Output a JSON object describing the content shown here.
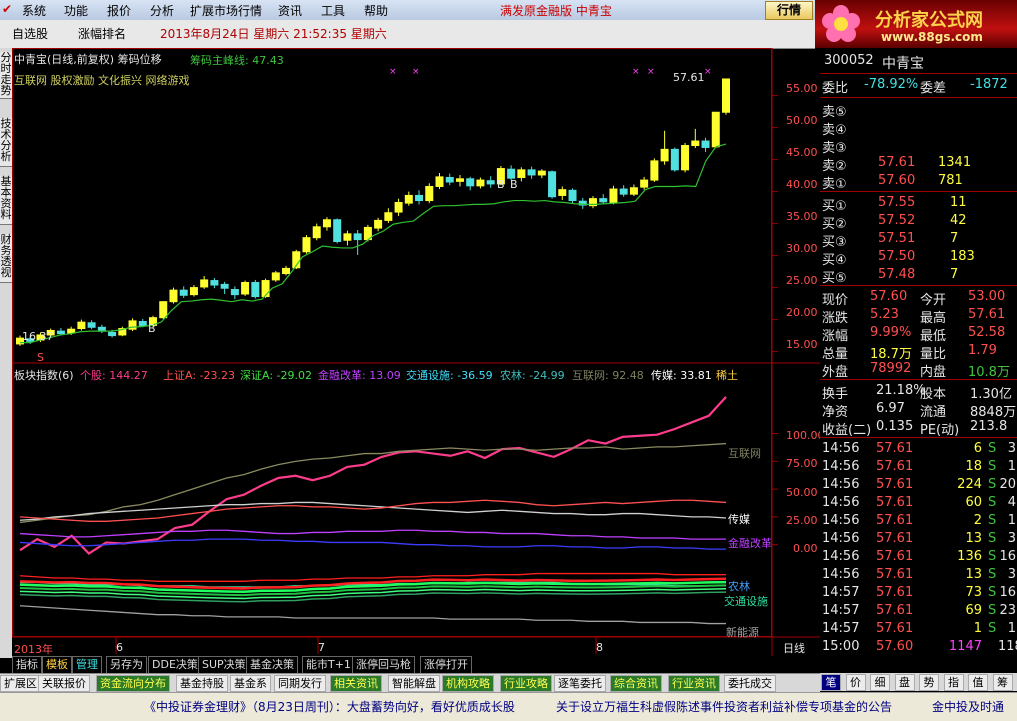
{
  "menu": {
    "items": [
      "系统",
      "功能",
      "报价",
      "分析",
      "扩展市场行情",
      "资讯",
      "工具",
      "帮助"
    ],
    "scroll_text": "满发原金融版  中青宝",
    "quote_button": "行情"
  },
  "banner": {
    "title": "分析家公式网",
    "url": "www.88gs.com"
  },
  "tabs": {
    "watchlist": "自选股",
    "ranking": "涨幅排名",
    "datetime": "2013年8月24日  星期六  21:52:35 星期六"
  },
  "side_tabs": [
    "分时走势",
    "技术分析",
    "基本资料",
    "财务透视"
  ],
  "main_chart": {
    "title": "中青宝(日线,前复权) 筹码位移",
    "indicator": "筹码主峰线: 47.43",
    "concepts": "互联网 股权激励 文化振兴 网络游戏",
    "high_label": "57.61",
    "low_label": "16.37",
    "b_marks": [
      "B",
      "B",
      "B"
    ],
    "s_mark": "S",
    "y_ticks": [
      "55.00",
      "50.00",
      "45.00",
      "40.00",
      "35.00",
      "30.00",
      "25.00",
      "20.00",
      "15.00"
    ]
  },
  "chart_data": {
    "type": "line",
    "x_labels": [
      "2013年",
      "6",
      "7",
      "8"
    ],
    "candles": [
      {
        "o": 16.2,
        "c": 17.1,
        "h": 17.5,
        "l": 15.9
      },
      {
        "o": 17.0,
        "c": 16.6,
        "h": 17.3,
        "l": 16.2
      },
      {
        "o": 16.8,
        "c": 17.6,
        "h": 18.0,
        "l": 16.5
      },
      {
        "o": 17.6,
        "c": 18.3,
        "h": 18.6,
        "l": 17.2
      },
      {
        "o": 18.2,
        "c": 17.8,
        "h": 18.7,
        "l": 17.5
      },
      {
        "o": 17.9,
        "c": 18.5,
        "h": 18.9,
        "l": 17.6
      },
      {
        "o": 18.6,
        "c": 19.6,
        "h": 20.0,
        "l": 18.3
      },
      {
        "o": 19.5,
        "c": 18.8,
        "h": 19.9,
        "l": 18.5
      },
      {
        "o": 18.8,
        "c": 18.2,
        "h": 19.2,
        "l": 17.9
      },
      {
        "o": 18.0,
        "c": 17.5,
        "h": 18.4,
        "l": 17.2
      },
      {
        "o": 17.6,
        "c": 18.6,
        "h": 18.9,
        "l": 17.4
      },
      {
        "o": 18.5,
        "c": 19.8,
        "h": 20.2,
        "l": 18.2
      },
      {
        "o": 19.7,
        "c": 19.0,
        "h": 20.1,
        "l": 18.8
      },
      {
        "o": 19.1,
        "c": 20.3,
        "h": 20.6,
        "l": 18.9
      },
      {
        "o": 20.3,
        "c": 22.8,
        "h": 22.9,
        "l": 20.1
      },
      {
        "o": 22.8,
        "c": 24.6,
        "h": 25.0,
        "l": 22.5
      },
      {
        "o": 24.6,
        "c": 23.8,
        "h": 25.2,
        "l": 23.4
      },
      {
        "o": 23.9,
        "c": 25.0,
        "h": 25.4,
        "l": 23.6
      },
      {
        "o": 25.1,
        "c": 26.2,
        "h": 26.8,
        "l": 24.8
      },
      {
        "o": 26.1,
        "c": 25.4,
        "h": 26.5,
        "l": 24.9
      },
      {
        "o": 25.5,
        "c": 24.9,
        "h": 25.9,
        "l": 24.0
      },
      {
        "o": 24.7,
        "c": 23.9,
        "h": 25.2,
        "l": 23.2
      },
      {
        "o": 24.0,
        "c": 25.8,
        "h": 26.1,
        "l": 23.7
      },
      {
        "o": 25.8,
        "c": 23.6,
        "h": 26.2,
        "l": 23.3
      },
      {
        "o": 23.6,
        "c": 26.1,
        "h": 26.4,
        "l": 23.4
      },
      {
        "o": 26.2,
        "c": 27.3,
        "h": 27.6,
        "l": 25.9
      },
      {
        "o": 27.2,
        "c": 28.0,
        "h": 28.4,
        "l": 26.9
      },
      {
        "o": 28.1,
        "c": 30.6,
        "h": 30.9,
        "l": 27.9
      },
      {
        "o": 30.6,
        "c": 32.8,
        "h": 33.2,
        "l": 30.3
      },
      {
        "o": 32.8,
        "c": 34.5,
        "h": 35.0,
        "l": 32.4
      },
      {
        "o": 34.5,
        "c": 35.6,
        "h": 36.0,
        "l": 33.9
      },
      {
        "o": 35.6,
        "c": 32.2,
        "h": 35.8,
        "l": 31.9
      },
      {
        "o": 32.4,
        "c": 33.4,
        "h": 33.9,
        "l": 31.6
      },
      {
        "o": 33.4,
        "c": 32.5,
        "h": 34.0,
        "l": 30.1
      },
      {
        "o": 32.5,
        "c": 34.4,
        "h": 34.8,
        "l": 32.2
      },
      {
        "o": 34.3,
        "c": 35.5,
        "h": 35.9,
        "l": 33.8
      },
      {
        "o": 35.5,
        "c": 36.7,
        "h": 37.4,
        "l": 35.1
      },
      {
        "o": 36.8,
        "c": 38.3,
        "h": 38.9,
        "l": 36.2
      },
      {
        "o": 38.2,
        "c": 39.4,
        "h": 40.0,
        "l": 37.8
      },
      {
        "o": 39.4,
        "c": 38.6,
        "h": 40.2,
        "l": 38.0
      },
      {
        "o": 38.6,
        "c": 40.8,
        "h": 41.3,
        "l": 38.2
      },
      {
        "o": 40.8,
        "c": 42.3,
        "h": 42.9,
        "l": 40.4
      },
      {
        "o": 42.2,
        "c": 41.5,
        "h": 42.8,
        "l": 41.0
      },
      {
        "o": 41.6,
        "c": 42.0,
        "h": 42.6,
        "l": 40.8
      },
      {
        "o": 42.0,
        "c": 40.9,
        "h": 42.3,
        "l": 40.2
      },
      {
        "o": 40.9,
        "c": 41.8,
        "h": 42.2,
        "l": 40.5
      },
      {
        "o": 41.7,
        "c": 41.2,
        "h": 42.4,
        "l": 40.6
      },
      {
        "o": 41.2,
        "c": 43.6,
        "h": 44.0,
        "l": 41.0
      },
      {
        "o": 43.5,
        "c": 42.1,
        "h": 44.1,
        "l": 41.8
      },
      {
        "o": 42.2,
        "c": 43.4,
        "h": 43.8,
        "l": 41.6
      },
      {
        "o": 43.4,
        "c": 42.6,
        "h": 43.9,
        "l": 42.0
      },
      {
        "o": 42.6,
        "c": 43.2,
        "h": 43.5,
        "l": 42.1
      },
      {
        "o": 43.1,
        "c": 39.2,
        "h": 43.3,
        "l": 38.9
      },
      {
        "o": 39.4,
        "c": 40.3,
        "h": 40.8,
        "l": 38.7
      },
      {
        "o": 40.2,
        "c": 38.6,
        "h": 40.5,
        "l": 38.1
      },
      {
        "o": 38.5,
        "c": 37.9,
        "h": 39.0,
        "l": 37.3
      },
      {
        "o": 37.8,
        "c": 38.9,
        "h": 39.3,
        "l": 37.4
      },
      {
        "o": 38.9,
        "c": 38.4,
        "h": 39.6,
        "l": 38.0
      },
      {
        "o": 38.3,
        "c": 40.4,
        "h": 40.9,
        "l": 38.0
      },
      {
        "o": 40.4,
        "c": 39.6,
        "h": 41.0,
        "l": 39.2
      },
      {
        "o": 39.6,
        "c": 40.6,
        "h": 41.1,
        "l": 39.3
      },
      {
        "o": 40.7,
        "c": 41.8,
        "h": 42.3,
        "l": 40.3
      },
      {
        "o": 41.8,
        "c": 44.8,
        "h": 45.2,
        "l": 41.5
      },
      {
        "o": 44.8,
        "c": 46.6,
        "h": 49.5,
        "l": 44.2
      },
      {
        "o": 46.6,
        "c": 43.4,
        "h": 46.9,
        "l": 43.1
      },
      {
        "o": 43.4,
        "c": 47.2,
        "h": 47.6,
        "l": 43.0
      },
      {
        "o": 47.2,
        "c": 47.9,
        "h": 49.8,
        "l": 46.8
      },
      {
        "o": 47.9,
        "c": 46.9,
        "h": 48.4,
        "l": 46.2
      },
      {
        "o": 47.0,
        "c": 52.4,
        "h": 52.4,
        "l": 46.8
      },
      {
        "o": 52.4,
        "c": 57.6,
        "h": 57.61,
        "l": 52.0
      }
    ],
    "support_line": [
      16.4,
      16.4,
      16.8,
      17.2,
      17.6,
      17.8,
      18.1,
      18.2,
      18.2,
      18.2,
      18.4,
      18.8,
      18.9,
      19.1,
      19.6,
      21.4,
      22.8,
      22.9,
      23.1,
      23.2,
      23.0,
      22.8,
      23.1,
      22.9,
      23.2,
      24.9,
      25.6,
      27.6,
      29.8,
      30.6,
      31.5,
      31.3,
      31.2,
      31.2,
      31.8,
      33.1,
      33.8,
      34.9,
      35.2,
      35.4,
      36.6,
      37.7,
      37.8,
      37.8,
      37.9,
      38.0,
      38.0,
      38.1,
      38.4,
      38.6,
      38.6,
      38.5,
      38.6,
      38.4,
      38.3,
      38.1,
      38.0,
      38.0,
      38.1,
      38.2,
      38.3,
      38.5,
      40.3,
      40.8,
      40.8,
      40.8,
      40.9,
      40.8,
      44.8,
      47.0,
      47.43
    ],
    "sector_series": [
      {
        "name": "个股",
        "color": "#ff3c8c",
        "values": [
          -5,
          5,
          -2,
          8,
          -8,
          2,
          1,
          3,
          5,
          15,
          18,
          30,
          41,
          45,
          53,
          60,
          62,
          58,
          62,
          70,
          72,
          79,
          83,
          84,
          82,
          80,
          84,
          78,
          86,
          87,
          83,
          79,
          86,
          94,
          91,
          97,
          98,
          99,
          104,
          110,
          116,
          133
        ]
      },
      {
        "name": "互联网",
        "color": "#8a8a60",
        "values": [
          20,
          22,
          24,
          26,
          27,
          30,
          34,
          36,
          40,
          45,
          50,
          55,
          60,
          63,
          68,
          72,
          75,
          77,
          78,
          80,
          82,
          82,
          84,
          85,
          86,
          87,
          86,
          85,
          86,
          86,
          85,
          86,
          87,
          87,
          88,
          86,
          87,
          88,
          88,
          89,
          90,
          91
        ]
      },
      {
        "name": "传媒",
        "color": "#d0d0d0",
        "values": [
          22,
          23,
          25,
          26,
          28,
          29,
          30,
          31,
          32,
          33,
          34,
          35,
          36,
          36,
          37,
          37,
          38,
          38,
          37,
          36,
          35,
          34,
          33,
          32,
          31,
          30,
          29,
          30,
          31,
          30,
          29,
          28,
          28,
          27,
          27,
          28,
          28,
          27,
          26,
          25,
          25,
          24
        ]
      },
      {
        "name": "上证A",
        "color": "#ff5050",
        "values": [
          25,
          24,
          23,
          22,
          21,
          21,
          22,
          23,
          24,
          26,
          28,
          30,
          32,
          33,
          34,
          35,
          35,
          34,
          34,
          33,
          32,
          33,
          35,
          37,
          38,
          38,
          39,
          40,
          39,
          38,
          36,
          35,
          36,
          37,
          38,
          37,
          38,
          39,
          40,
          40,
          39,
          38
        ]
      },
      {
        "name": "金融改革",
        "color": "#c040ff",
        "values": [
          10,
          9,
          8,
          7,
          7,
          8,
          9,
          10,
          11,
          12,
          12,
          13,
          13,
          12,
          11,
          10,
          10,
          11,
          11,
          12,
          12,
          12,
          13,
          13,
          12,
          12,
          11,
          11,
          10,
          10,
          10,
          9,
          8,
          8,
          7,
          7,
          6,
          6,
          6,
          5,
          5,
          5
        ]
      },
      {
        "name": "深证A",
        "color": "#3c3cff",
        "values": [
          2,
          1,
          0,
          -1,
          -1,
          0,
          1,
          2,
          3,
          4,
          4,
          5,
          5,
          5,
          4,
          4,
          3,
          3,
          2,
          2,
          2,
          2,
          1,
          0,
          0,
          -1,
          -1,
          -2,
          -2,
          -2,
          -1,
          -1,
          -2,
          -2,
          -3,
          -3,
          -2,
          -2,
          -3,
          -3,
          -4,
          -4
        ]
      },
      {
        "name": "农林",
        "color": "#ff2020",
        "values": [
          -28,
          -29,
          -30,
          -30,
          -31,
          -31,
          -32,
          -32,
          -33,
          -33,
          -33,
          -33,
          -33,
          -33,
          -32,
          -32,
          -32,
          -31,
          -31,
          -30,
          -30,
          -30,
          -29,
          -29,
          -28,
          -28,
          -28,
          -27,
          -27,
          -27,
          -26,
          -26,
          -26,
          -26,
          -26,
          -26,
          -26,
          -26,
          -27,
          -27,
          -27,
          -27
        ]
      },
      {
        "name": "交通设施",
        "color": "#30e0a0",
        "values": [
          -34,
          -34,
          -35,
          -35,
          -36,
          -36,
          -36,
          -37,
          -37,
          -37,
          -37,
          -38,
          -38,
          -38,
          -38,
          -38,
          -37,
          -37,
          -37,
          -36,
          -36,
          -36,
          -35,
          -35,
          -35,
          -35,
          -34,
          -34,
          -34,
          -34,
          -34,
          -34,
          -35,
          -35,
          -36,
          -36,
          -36,
          -36,
          -37,
          -37,
          -37,
          -37
        ]
      },
      {
        "name": "新能源",
        "color": "#a0a0a0",
        "values": [
          -55,
          -56,
          -57,
          -58,
          -59,
          -60,
          -61,
          -62,
          -63,
          -63,
          -64,
          -64,
          -65,
          -65,
          -65,
          -65,
          -66,
          -66,
          -66,
          -66,
          -66,
          -66,
          -66,
          -66,
          -66,
          -67,
          -67,
          -67,
          -67,
          -67,
          -68,
          -68,
          -68,
          -69,
          -69,
          -69,
          -70,
          -70,
          -70,
          -70,
          -71,
          -71
        ]
      }
    ],
    "ylim_price": [
      14,
      59
    ],
    "ylim_sector": [
      -75,
      150
    ]
  },
  "sector_panel": {
    "title": "板块指数(6)",
    "values": [
      {
        "label": "个股: 144.27",
        "color": "#ff3c8c"
      },
      {
        "label": "上证A: -23.23",
        "color": "#ff5050"
      },
      {
        "label": "深证A: -29.02",
        "color": "#40e040"
      },
      {
        "label": "金融改革: 13.09",
        "color": "#c040ff"
      },
      {
        "label": "交通设施: -36.59",
        "color": "#40e0ff"
      },
      {
        "label": "农林: -24.99",
        "color": "#40c0c0"
      },
      {
        "label": "互联网: 92.48",
        "color": "#808060"
      },
      {
        "label": "传媒: 33.81",
        "color": "#ffffff"
      },
      {
        "label": "稀土",
        "color": "#ffd040"
      }
    ],
    "y_ticks": [
      "100.00",
      "75.00",
      "50.00",
      "25.00",
      "0.00"
    ],
    "right_labels": {
      "internet": "互联网",
      "media": "传媒",
      "finance": "金融改革",
      "transport": "交通设施",
      "agri": "农林",
      "newenergy": "新能源"
    },
    "period": "日线",
    "nav": "◀ ▶"
  },
  "quote": {
    "code": "300052",
    "name": "中青宝",
    "ratio_label": "委比",
    "ratio": "-78.92%",
    "diff_label": "委差",
    "diff": "-1872",
    "asks": [
      {
        "label": "卖⑤",
        "price": "",
        "vol": ""
      },
      {
        "label": "卖④",
        "price": "",
        "vol": ""
      },
      {
        "label": "卖③",
        "price": "",
        "vol": ""
      },
      {
        "label": "卖②",
        "price": "57.61",
        "vol": "1341"
      },
      {
        "label": "卖①",
        "price": "57.60",
        "vol": "781"
      }
    ],
    "bids": [
      {
        "label": "买①",
        "price": "57.55",
        "vol": "11"
      },
      {
        "label": "买②",
        "price": "57.52",
        "vol": "42"
      },
      {
        "label": "买③",
        "price": "57.51",
        "vol": "7"
      },
      {
        "label": "买④",
        "price": "57.50",
        "vol": "183"
      },
      {
        "label": "买⑤",
        "price": "57.48",
        "vol": "7"
      }
    ],
    "stats": [
      {
        "l1": "现价",
        "v1": "57.60",
        "c1": "red",
        "l2": "今开",
        "v2": "53.00",
        "c2": "red"
      },
      {
        "l1": "涨跌",
        "v1": "5.23",
        "c1": "red",
        "l2": "最高",
        "v2": "57.61",
        "c2": "red"
      },
      {
        "l1": "涨幅",
        "v1": "9.99%",
        "c1": "red",
        "l2": "最低",
        "v2": "52.58",
        "c2": "red"
      },
      {
        "l1": "总量",
        "v1": "18.7万",
        "c1": "yel",
        "l2": "量比",
        "v2": "1.79",
        "c2": "red"
      },
      {
        "l1": "外盘",
        "v1": "78992",
        "c1": "red",
        "l2": "内盘",
        "v2": "10.8万",
        "c2": "grn"
      }
    ],
    "stats2": [
      {
        "l1": "换手",
        "v1": "21.18%",
        "l2": "股本",
        "v2": "1.30亿"
      },
      {
        "l1": "净资",
        "v1": "6.97",
        "l2": "流通",
        "v2": "8848万"
      },
      {
        "l1": "收益(二)",
        "v1": "0.135",
        "l2": "PE(动)",
        "v2": "213.8"
      }
    ],
    "ticks": [
      {
        "t": "14:56",
        "p": "57.61",
        "v": "6",
        "bs": "S",
        "n": "3"
      },
      {
        "t": "14:56",
        "p": "57.61",
        "v": "18",
        "bs": "S",
        "n": "1"
      },
      {
        "t": "14:56",
        "p": "57.61",
        "v": "224",
        "bs": "S",
        "n": "20"
      },
      {
        "t": "14:56",
        "p": "57.61",
        "v": "60",
        "bs": "S",
        "n": "4"
      },
      {
        "t": "14:56",
        "p": "57.61",
        "v": "2",
        "bs": "S",
        "n": "1"
      },
      {
        "t": "14:56",
        "p": "57.61",
        "v": "13",
        "bs": "S",
        "n": "3"
      },
      {
        "t": "14:56",
        "p": "57.61",
        "v": "136",
        "bs": "S",
        "n": "16"
      },
      {
        "t": "14:56",
        "p": "57.61",
        "v": "13",
        "bs": "S",
        "n": "3"
      },
      {
        "t": "14:57",
        "p": "57.61",
        "v": "73",
        "bs": "S",
        "n": "16"
      },
      {
        "t": "14:57",
        "p": "57.61",
        "v": "69",
        "bs": "S",
        "n": "23"
      },
      {
        "t": "14:57",
        "p": "57.61",
        "v": "1",
        "bs": "S",
        "n": "1"
      },
      {
        "t": "15:00",
        "p": "57.60",
        "v": "1147",
        "bs": "",
        "n": "118"
      }
    ]
  },
  "bottom_tabs": [
    "指标",
    "模板",
    "管理",
    "另存为",
    "DDE决策",
    "SUP决策",
    "基金决策",
    "能市T+1",
    "涨停回马枪",
    "涨停打开"
  ],
  "func_tabs": [
    "扩展区",
    "关联报价",
    "资金流向分布",
    "基金持股",
    "基金系",
    "同期发行",
    "相关资讯",
    "智能解盘",
    "机构攻略",
    "行业攻略",
    "逐笔委托",
    "综合资讯",
    "行业资讯",
    "委托成交"
  ],
  "right_tabs": [
    "笔",
    "价",
    "细",
    "盘",
    "势",
    "指",
    "值",
    "筹"
  ],
  "ticker": {
    "left": "《中投证券金理财》（8月23日周刊）：大盘蓄势向好，看好优质成长股",
    "mid": "关于设立万福生科虚假陈述事件投资者利益补偿专项基金的公告",
    "right": "金中投及时通"
  }
}
